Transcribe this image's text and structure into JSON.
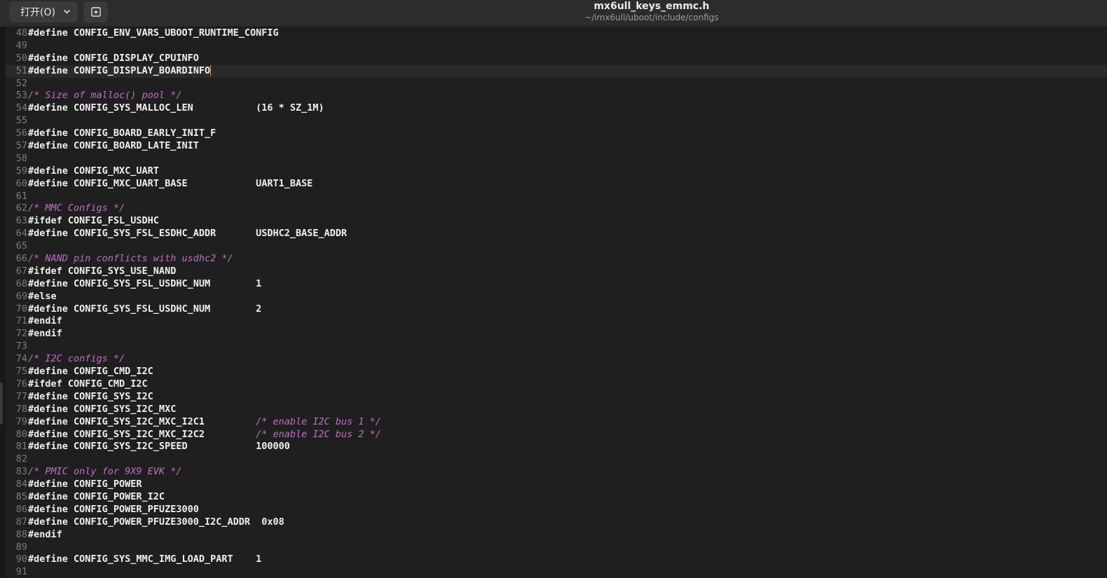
{
  "header": {
    "open_label": "打开(O)",
    "title": "mx6ull_keys_emmc.h",
    "subtitle": "~/imx6ull/uboot/include/configs"
  },
  "editor": {
    "current_line": 51,
    "lines": [
      {
        "n": "48",
        "t": "#define CONFIG_ENV_VARS_UBOOT_RUNTIME_CONFIG"
      },
      {
        "n": "49",
        "t": ""
      },
      {
        "n": "50",
        "t": "#define CONFIG_DISPLAY_CPUINFO"
      },
      {
        "n": "51",
        "t": "#define CONFIG_DISPLAY_BOARDINFO"
      },
      {
        "n": "52",
        "t": ""
      },
      {
        "n": "53",
        "t": "",
        "c": "/* Size of malloc() pool */"
      },
      {
        "n": "54",
        "t": "#define CONFIG_SYS_MALLOC_LEN           (16 * SZ_1M)"
      },
      {
        "n": "55",
        "t": ""
      },
      {
        "n": "56",
        "t": "#define CONFIG_BOARD_EARLY_INIT_F"
      },
      {
        "n": "57",
        "t": "#define CONFIG_BOARD_LATE_INIT"
      },
      {
        "n": "58",
        "t": ""
      },
      {
        "n": "59",
        "t": "#define CONFIG_MXC_UART"
      },
      {
        "n": "60",
        "t": "#define CONFIG_MXC_UART_BASE            UART1_BASE"
      },
      {
        "n": "61",
        "t": ""
      },
      {
        "n": "62",
        "t": "",
        "c": "/* MMC Configs */"
      },
      {
        "n": "63",
        "t": "#ifdef CONFIG_FSL_USDHC"
      },
      {
        "n": "64",
        "t": "#define CONFIG_SYS_FSL_ESDHC_ADDR       USDHC2_BASE_ADDR"
      },
      {
        "n": "65",
        "t": ""
      },
      {
        "n": "66",
        "t": "",
        "c": "/* NAND pin conflicts with usdhc2 */"
      },
      {
        "n": "67",
        "t": "#ifdef CONFIG_SYS_USE_NAND"
      },
      {
        "n": "68",
        "t": "#define CONFIG_SYS_FSL_USDHC_NUM        1"
      },
      {
        "n": "69",
        "t": "#else"
      },
      {
        "n": "70",
        "t": "#define CONFIG_SYS_FSL_USDHC_NUM        2"
      },
      {
        "n": "71",
        "t": "#endif"
      },
      {
        "n": "72",
        "t": "#endif"
      },
      {
        "n": "73",
        "t": ""
      },
      {
        "n": "74",
        "t": "",
        "c": "/* I2C configs */"
      },
      {
        "n": "75",
        "t": "#define CONFIG_CMD_I2C"
      },
      {
        "n": "76",
        "t": "#ifdef CONFIG_CMD_I2C"
      },
      {
        "n": "77",
        "t": "#define CONFIG_SYS_I2C"
      },
      {
        "n": "78",
        "t": "#define CONFIG_SYS_I2C_MXC"
      },
      {
        "n": "79",
        "t": "#define CONFIG_SYS_I2C_MXC_I2C1         ",
        "c": "/* enable I2C bus 1 */"
      },
      {
        "n": "80",
        "t": "#define CONFIG_SYS_I2C_MXC_I2C2         ",
        "c": "/* enable I2C bus 2 */"
      },
      {
        "n": "81",
        "t": "#define CONFIG_SYS_I2C_SPEED            100000"
      },
      {
        "n": "82",
        "t": ""
      },
      {
        "n": "83",
        "t": "",
        "c": "/* PMIC only for 9X9 EVK */"
      },
      {
        "n": "84",
        "t": "#define CONFIG_POWER"
      },
      {
        "n": "85",
        "t": "#define CONFIG_POWER_I2C"
      },
      {
        "n": "86",
        "t": "#define CONFIG_POWER_PFUZE3000"
      },
      {
        "n": "87",
        "t": "#define CONFIG_POWER_PFUZE3000_I2C_ADDR  0x08"
      },
      {
        "n": "88",
        "t": "#endif"
      },
      {
        "n": "89",
        "t": ""
      },
      {
        "n": "90",
        "t": "#define CONFIG_SYS_MMC_IMG_LOAD_PART    1"
      },
      {
        "n": "91",
        "t": ""
      }
    ]
  }
}
